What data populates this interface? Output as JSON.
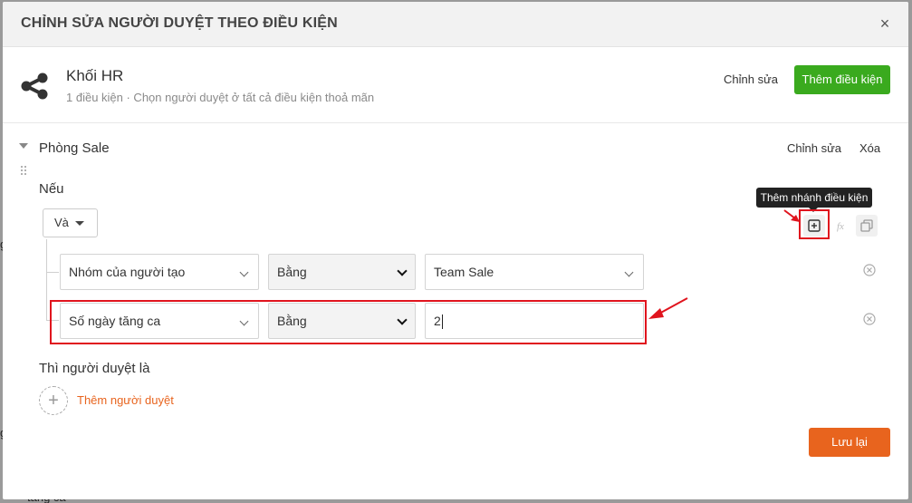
{
  "background": {
    "edge_text_1": "g",
    "edge_text_2": "tăng ca"
  },
  "modal": {
    "title": "CHỈNH SỬA NGƯỜI DUYỆT THEO ĐIỀU KIỆN",
    "close_symbol": "×"
  },
  "group": {
    "icon": "share-network-icon",
    "title": "Khối HR",
    "subtitle": "1 điều kiện · Chọn người duyệt ở tất cả điều kiện thoả mãn",
    "edit_label": "Chỉnh sửa",
    "add_condition_label": "Thêm điều kiện"
  },
  "branch": {
    "title": "Phòng Sale",
    "edit_label": "Chỉnh sửa",
    "delete_label": "Xóa",
    "if_label": "Nếu",
    "operator": "Và",
    "tooltip": "Thêm nhánh điều kiện",
    "conditions": [
      {
        "field": "Nhóm của người tạo",
        "comparator": "Bằng",
        "value": "Team Sale"
      },
      {
        "field": "Số ngày tăng ca",
        "comparator": "Bằng",
        "value": "2"
      }
    ]
  },
  "approver": {
    "title": "Thì người duyệt là",
    "add_label": "Thêm người duyệt",
    "add_symbol": "+"
  },
  "footer": {
    "save_label": "Lưu lại"
  },
  "colors": {
    "accent_green": "#3aaa1e",
    "accent_orange": "#e8641e",
    "highlight_red": "#e0141e"
  }
}
